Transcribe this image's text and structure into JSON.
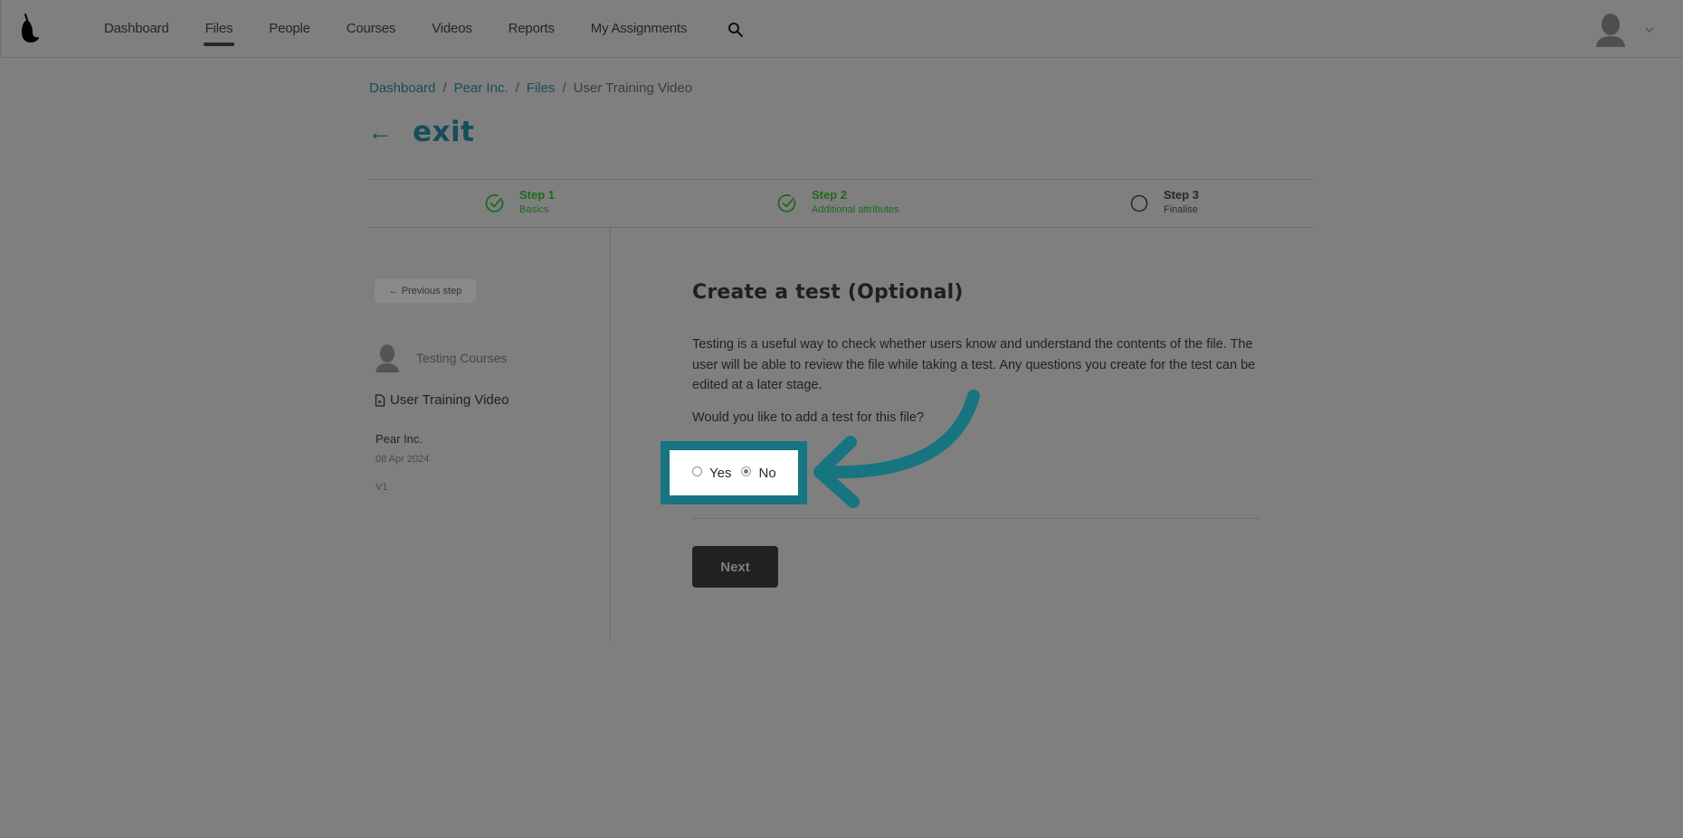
{
  "topbar": {
    "logo": "pear-logo",
    "nav": [
      {
        "label": "Dashboard",
        "active": false
      },
      {
        "label": "Files",
        "active": true
      },
      {
        "label": "People",
        "active": false
      },
      {
        "label": "Courses",
        "active": false
      },
      {
        "label": "Videos",
        "active": false
      },
      {
        "label": "Reports",
        "active": false
      },
      {
        "label": "My Assignments",
        "active": false
      }
    ],
    "search_icon": "search-icon",
    "avatar_icon": "user-avatar-icon",
    "menu_icon": "chevron-down-icon"
  },
  "breadcrumb": {
    "items": [
      "Dashboard",
      "Pear Inc.",
      "Files"
    ],
    "separator": "/",
    "current": "User Training Video"
  },
  "exit": {
    "arrow": "←",
    "label": "exit"
  },
  "steps": [
    {
      "title": "Step 1",
      "subtitle": "Basics",
      "status": "complete"
    },
    {
      "title": "Step 2",
      "subtitle": "Additional attributes",
      "status": "complete"
    },
    {
      "title": "Step 3",
      "subtitle": "Finalise",
      "status": "pending"
    }
  ],
  "sidebar": {
    "previous_step_label": "← Previous step",
    "owner_name": "Testing Courses",
    "file_name": "User Training Video",
    "organization": "Pear Inc.",
    "date": "08 Apr 2024",
    "version": "V1"
  },
  "main": {
    "title": "Create a test (Optional)",
    "description": "Testing is a useful way to check whether users know and understand the contents of the file. The user will be able to review the file while taking a test. Any questions you create for the test can be edited at a later stage.",
    "question": "Would you like to add a test for this file?",
    "options": [
      {
        "label": "Yes",
        "selected": false
      },
      {
        "label": "No",
        "selected": true
      }
    ],
    "next_label": "Next"
  },
  "annotation": {
    "highlight_color": "#167580",
    "arrow_color": "#167580"
  },
  "colors": {
    "overlay_bg": "#7f7f7f",
    "link": "#154f58",
    "step_complete": "#1d6a1d",
    "primary_button": "#222222"
  }
}
